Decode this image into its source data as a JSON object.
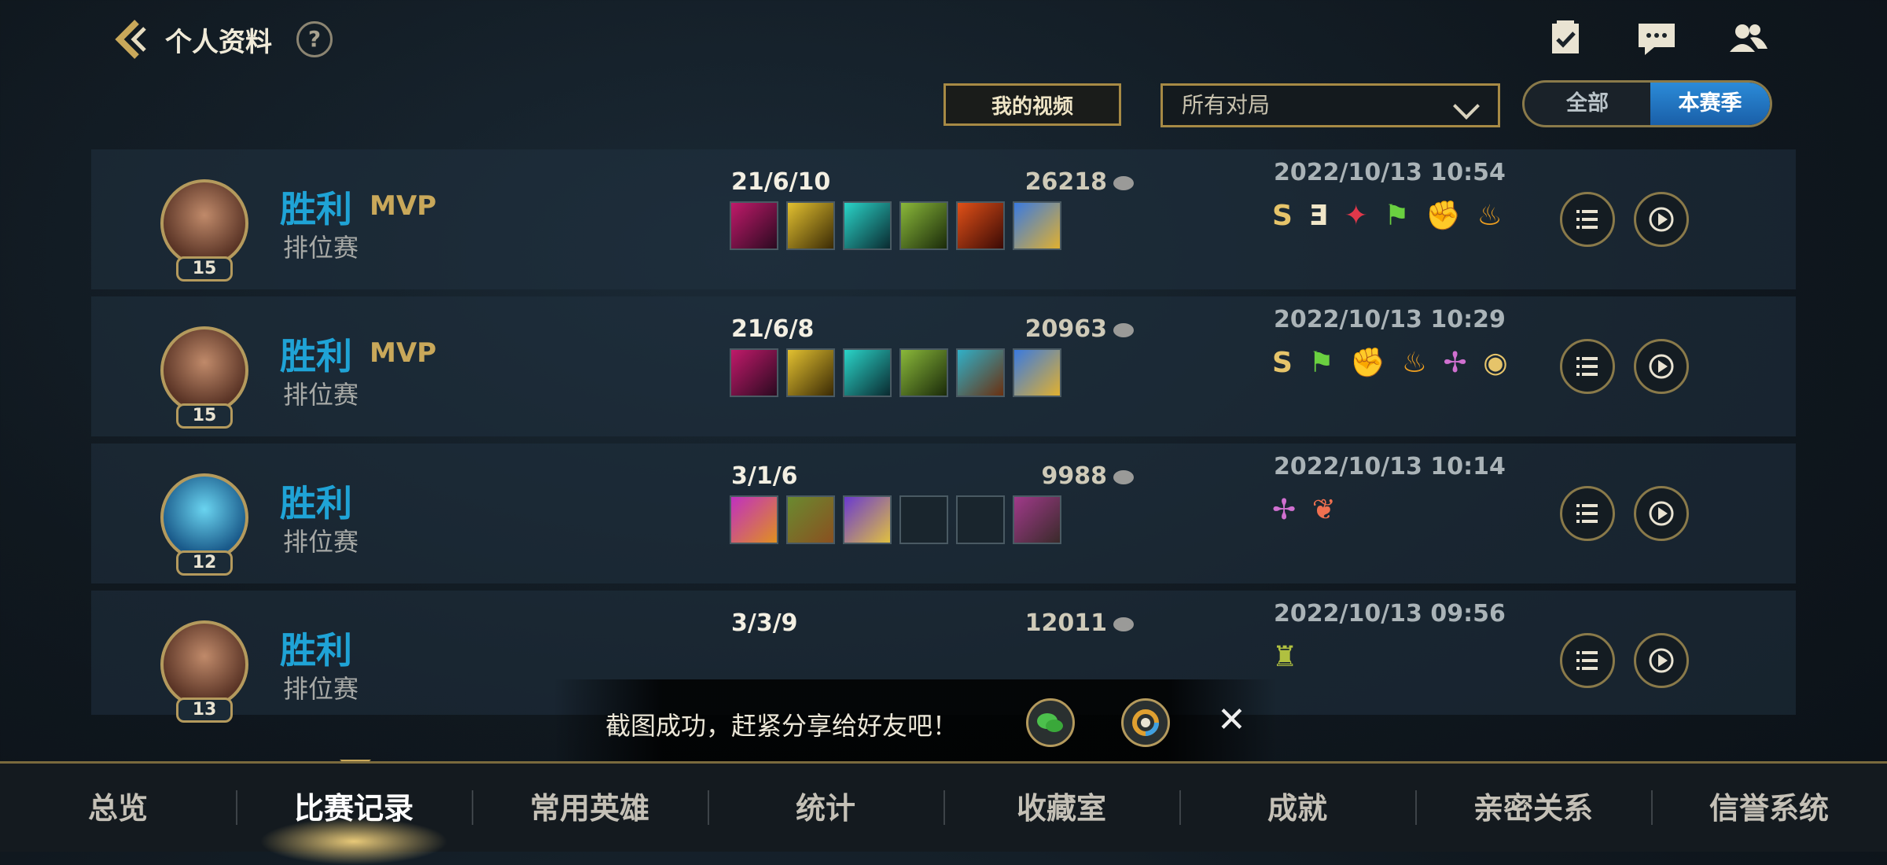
{
  "header": {
    "title": "个人资料",
    "help": "?"
  },
  "controls": {
    "my_video": "我的视频",
    "filter_selected": "所有对局",
    "seg_all": "全部",
    "seg_season": "本赛季"
  },
  "matches": [
    {
      "level": "15",
      "result": "胜利",
      "mvp": "MVP",
      "mode": "排位赛",
      "kda": "21/6/10",
      "gold": "26218",
      "datetime": "2022/10/13 10:54",
      "badge_text": [
        "S",
        "Ǝ"
      ]
    },
    {
      "level": "15",
      "result": "胜利",
      "mvp": "MVP",
      "mode": "排位赛",
      "kda": "21/6/8",
      "gold": "20963",
      "datetime": "2022/10/13 10:29",
      "badge_text": [
        "S"
      ]
    },
    {
      "level": "12",
      "result": "胜利",
      "mvp": "",
      "mode": "排位赛",
      "kda": "3/1/6",
      "gold": "9988",
      "datetime": "2022/10/13 10:14",
      "badge_text": []
    },
    {
      "level": "13",
      "result": "胜利",
      "mvp": "",
      "mode": "排位赛",
      "kda": "3/3/9",
      "gold": "12011",
      "datetime": "2022/10/13 09:56",
      "badge_text": []
    }
  ],
  "toast": {
    "text": "截图成功，赶紧分享给好友吧！"
  },
  "nav": {
    "tabs": [
      "总览",
      "比赛记录",
      "常用英雄",
      "统计",
      "收藏室",
      "成就",
      "亲密关系",
      "信誉系统"
    ],
    "active": "比赛记录"
  },
  "colors": {
    "win": "#1fa3d6",
    "gold_accent": "#c9a85a",
    "active_seg": "#1a6fc0"
  }
}
